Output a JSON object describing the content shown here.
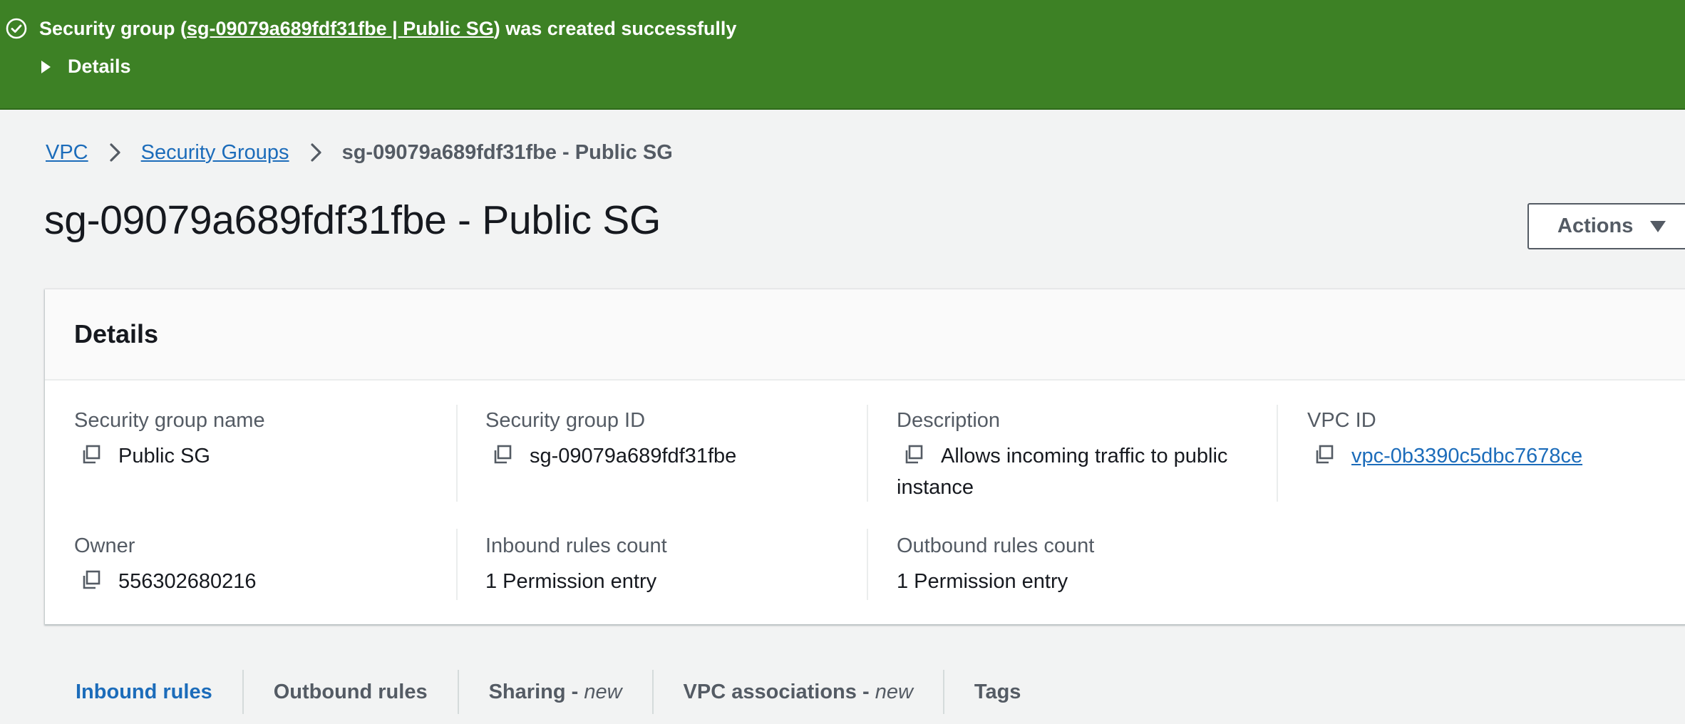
{
  "flash": {
    "prefix": "Security group (",
    "link": "sg-09079a689fdf31fbe | Public SG",
    "suffix": ") was created successfully",
    "details_label": "Details",
    "color": "#3d8125"
  },
  "breadcrumb": {
    "items": [
      "VPC",
      "Security Groups"
    ],
    "current": "sg-09079a689fdf31fbe - Public SG"
  },
  "page_title": "sg-09079a689fdf31fbe - Public SG",
  "actions_label": "Actions",
  "details": {
    "title": "Details",
    "fields": {
      "sg_name": {
        "label": "Security group name",
        "value": "Public SG"
      },
      "sg_id": {
        "label": "Security group ID",
        "value": "sg-09079a689fdf31fbe"
      },
      "description": {
        "label": "Description",
        "value": "Allows incoming traffic to public instance"
      },
      "vpc_id": {
        "label": "VPC ID",
        "value": "vpc-0b3390c5dbc7678ce"
      },
      "owner": {
        "label": "Owner",
        "value": "556302680216"
      },
      "inbound_count": {
        "label": "Inbound rules count",
        "value": "1 Permission entry"
      },
      "outbound_count": {
        "label": "Outbound rules count",
        "value": "1 Permission entry"
      }
    }
  },
  "tabs": [
    {
      "label": "Inbound rules",
      "badge": ""
    },
    {
      "label": "Outbound rules",
      "badge": ""
    },
    {
      "label": "Sharing - ",
      "badge": "new"
    },
    {
      "label": "VPC associations - ",
      "badge": "new"
    },
    {
      "label": "Tags",
      "badge": ""
    }
  ],
  "colors": {
    "link": "#1c6cba",
    "success": "#3d8125"
  },
  "icons": {
    "flash": "success-check-icon",
    "copy": "copy-icon",
    "breadcrumb_separator": "chevron-right-icon",
    "details_toggle": "caret-right-icon",
    "actions": "caret-down-icon"
  }
}
